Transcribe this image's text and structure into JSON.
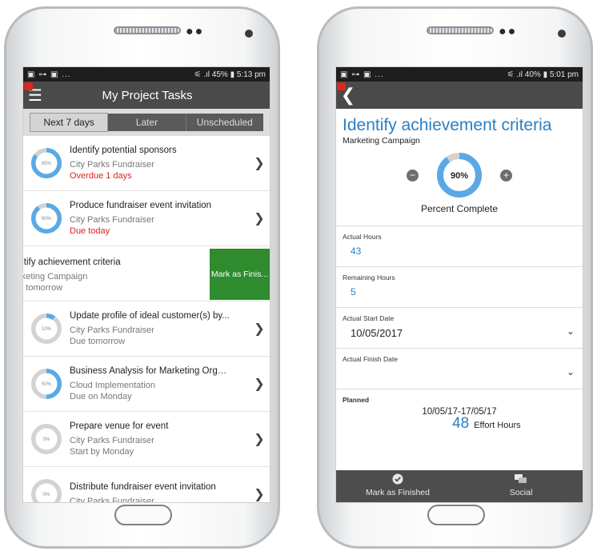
{
  "left_screen": {
    "status": {
      "left_icons": "▣ ⊶ ▣ ...",
      "right": "⚟ .ıl 45% ▮ 5:13 pm"
    },
    "header": {
      "title": "My Project Tasks"
    },
    "tabs": [
      {
        "label": "Next 7 days",
        "active": true
      },
      {
        "label": "Later",
        "active": false
      },
      {
        "label": "Unscheduled",
        "active": false
      }
    ],
    "tasks": [
      {
        "name": "Identify potential sponsors",
        "project": "City Parks Fundraiser",
        "due": "Overdue 1 days",
        "due_color": "red",
        "percent_label": "85%",
        "percent": 85
      },
      {
        "name": "Produce fundraiser event invitation",
        "project": "City Parks Fundraiser",
        "due": "Due today",
        "due_color": "red",
        "percent_label": "90%",
        "percent": 90
      },
      {
        "name": "Update profile of ideal customer(s) by...",
        "project": "City Parks Fundraiser",
        "due": "Due tomorrow",
        "due_color": "gray",
        "percent_label": "10%",
        "percent": 10
      },
      {
        "name": "Business Analysis for Marketing Orga...",
        "project": "Cloud Implementation",
        "due": "Due on Monday",
        "due_color": "gray",
        "percent_label": "50%",
        "percent": 50
      },
      {
        "name": "Prepare venue for event",
        "project": "City Parks Fundraiser",
        "due": "Start by Monday",
        "due_color": "gray",
        "percent_label": "0%",
        "percent": 0
      },
      {
        "name": "Distribute fundraiser event invitation",
        "project": "City Parks Fundraiser",
        "due": "",
        "due_color": "gray",
        "percent_label": "0%",
        "percent": 0
      }
    ],
    "swiped_task": {
      "name": "entify achievement criteria",
      "project": "arketing Campaign",
      "due": "ue tomorrow",
      "action": "Mark as Finis..."
    }
  },
  "right_screen": {
    "status": {
      "left_icons": "▣ ⊶ ▣ ...",
      "right": "⚟ .ıl 40% ▮ 5:01 pm"
    },
    "title": "Identify achievement criteria",
    "project": "Marketing Campaign",
    "percent_label": "90%",
    "percent": 90,
    "percent_caption": "Percent Complete",
    "fields": {
      "actual_hours": {
        "label": "Actual Hours",
        "value": "43"
      },
      "remaining_hours": {
        "label": "Remaining Hours",
        "value": "5"
      },
      "actual_start": {
        "label": "Actual Start Date",
        "value": "10/05/2017"
      },
      "actual_finish": {
        "label": "Actual Finish Date",
        "value": ""
      }
    },
    "planned": {
      "label": "Planned",
      "dates": "10/05/17-17/05/17",
      "effort_value": "48",
      "effort_label": "Effort Hours"
    },
    "bottom_bar": [
      {
        "label": "Mark as Finished",
        "icon": "check-circle-icon"
      },
      {
        "label": "Social",
        "icon": "chat-bubbles-icon"
      }
    ]
  },
  "colors": {
    "accent": "#2a7fc4",
    "ring_fill": "#5aa9e6",
    "ring_track": "#d3d3d3",
    "overdue": "#d7261b",
    "finish_action": "#2e8b2e",
    "appbar": "#4a4a4a"
  }
}
